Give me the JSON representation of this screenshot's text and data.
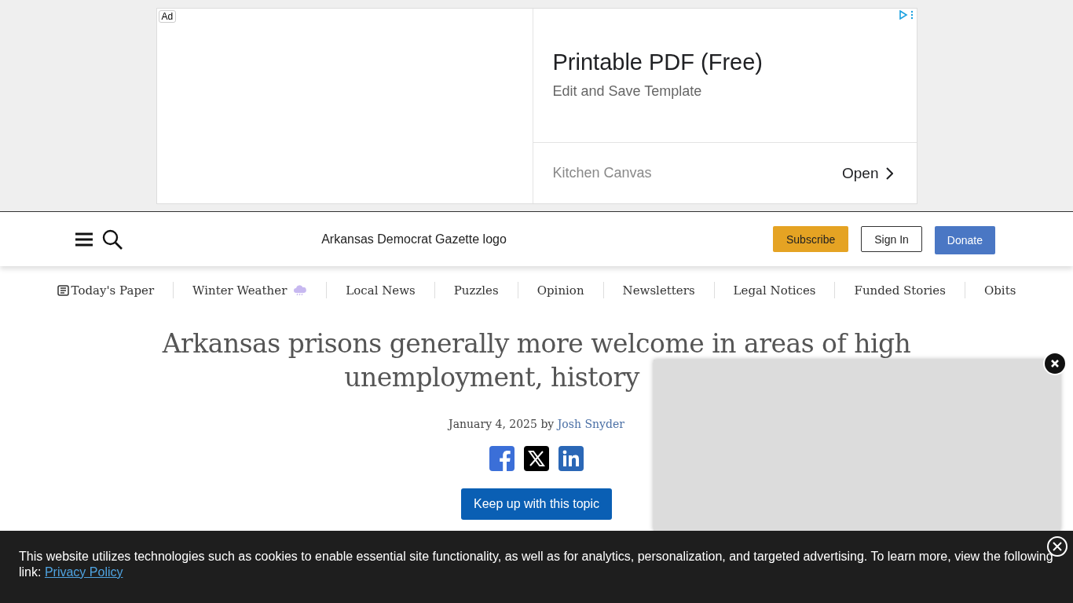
{
  "ad": {
    "badge": "Ad",
    "headline": "Printable PDF (Free)",
    "subline": "Edit and Save Template",
    "advertiser": "Kitchen Canvas",
    "cta": "Open"
  },
  "header": {
    "logo_alt": "Arkansas Democrat Gazette logo",
    "buttons": [
      {
        "label": "Subscribe",
        "kind": "subscribe"
      },
      {
        "label": "Sign In",
        "kind": "signin"
      },
      {
        "label": "Donate",
        "kind": "donate"
      }
    ]
  },
  "nav": [
    {
      "label": "Today's Paper",
      "kind": "paper"
    },
    {
      "label": "Winter Weather",
      "kind": "weather"
    },
    {
      "label": "Local News",
      "kind": "plain"
    },
    {
      "label": "Puzzles",
      "kind": "plain"
    },
    {
      "label": "Opinion",
      "kind": "plain"
    },
    {
      "label": "Newsletters",
      "kind": "plain"
    },
    {
      "label": "Legal Notices",
      "kind": "plain"
    },
    {
      "label": "Funded Stories",
      "kind": "plain"
    },
    {
      "label": "Obits",
      "kind": "plain"
    }
  ],
  "article": {
    "title_lines": [
      "Arkansas prisons generally more welcome in areas of high",
      "unemployment, history"
    ],
    "date": "January 4, 2025",
    "by": "by",
    "author": "Josh Snyder",
    "share": [
      {
        "kind": "facebook"
      },
      {
        "kind": "x"
      },
      {
        "kind": "linkedin"
      }
    ],
    "follow_button": "Keep up with this topic"
  },
  "cookie_banner": {
    "text": "This website utilizes technologies such as cookies to enable essential site functionality, as well as for analytics, personalization, and targeted advertising. To learn more, view the following link:",
    "link": "Privacy Policy"
  }
}
